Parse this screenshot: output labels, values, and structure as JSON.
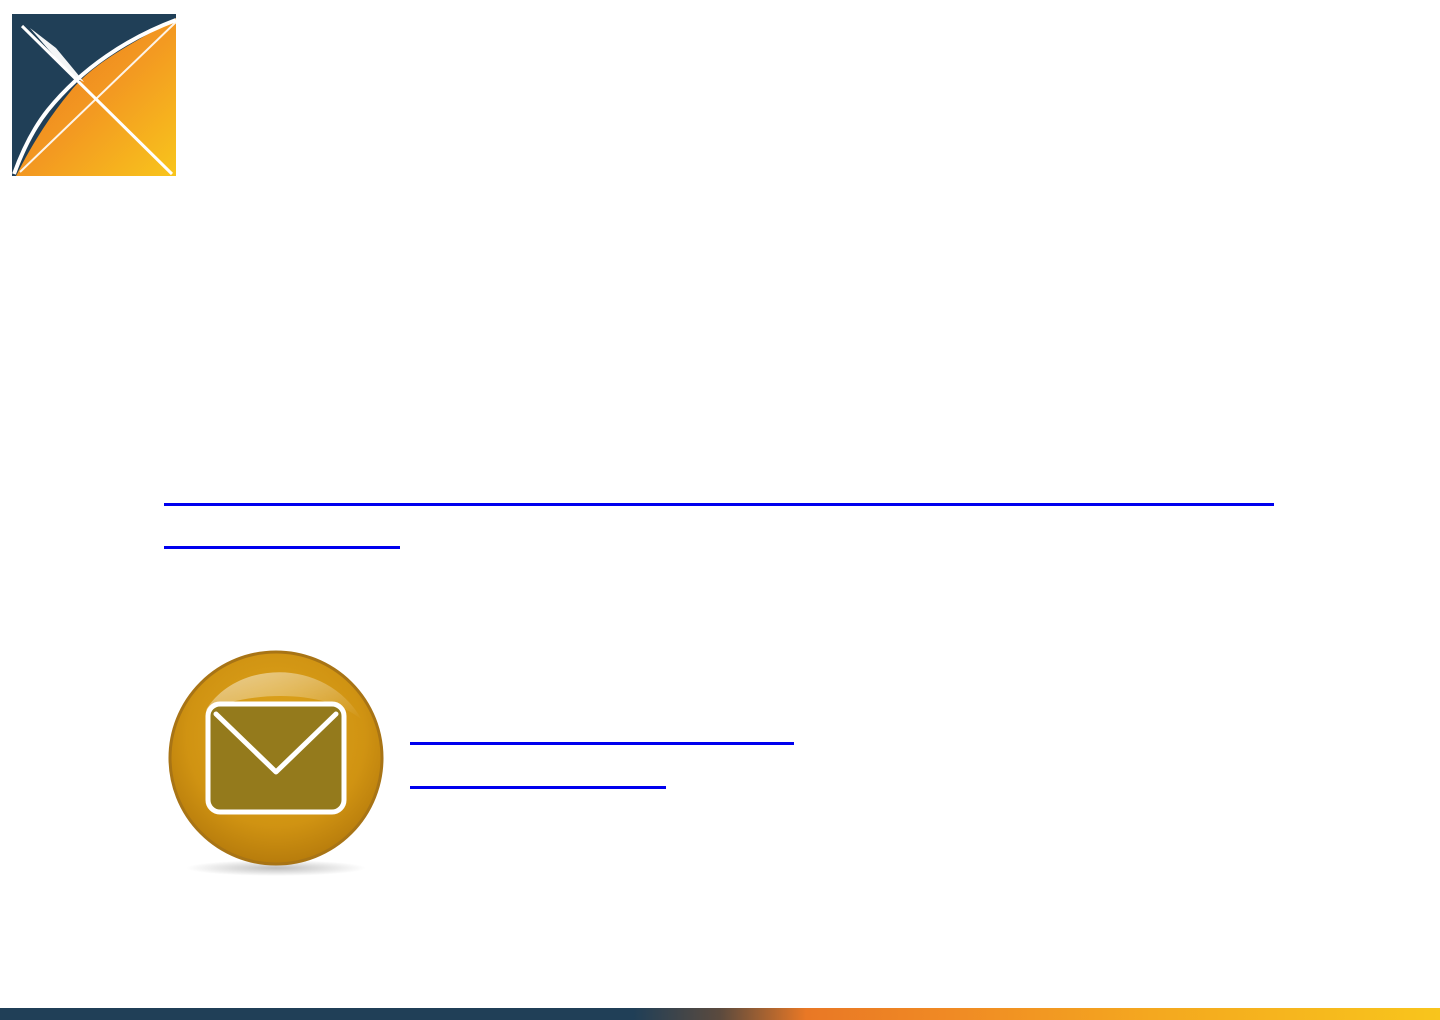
{
  "colors": {
    "navy": "#203f57",
    "orange": "#f08a24",
    "yellow": "#f8c51c",
    "link": "#0000ee",
    "mail_gold": "#d09312",
    "mail_olive": "#947a1c"
  },
  "logo": {
    "icon": "x-logo-icon"
  },
  "main_link": {
    "line_1": "",
    "line_2": ""
  },
  "contact": {
    "icon": "mail-icon",
    "line_1": "",
    "line_2": ""
  },
  "footer": {
    "style": "gradient-bar"
  }
}
